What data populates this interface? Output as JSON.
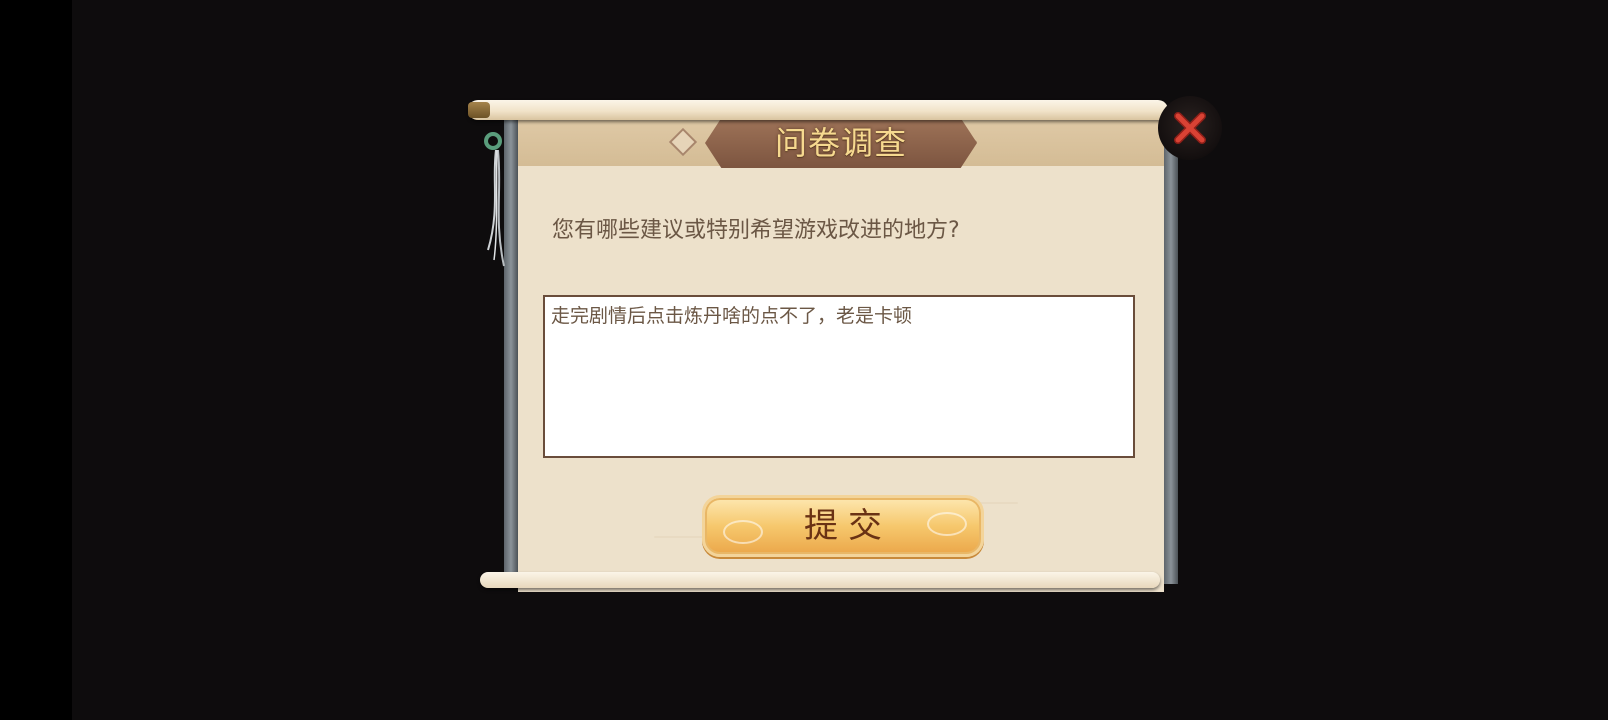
{
  "dialog": {
    "title": "问卷调查",
    "question": "您有哪些建议或特别希望游戏改进的地方?",
    "answer_value": "走完剧情后点击炼丹啥的点不了，老是卡顿",
    "submit_label": "提交"
  },
  "icons": {
    "close": "close-x-icon",
    "ornament": "jade-pendant-icon"
  },
  "colors": {
    "background": "#0e0c0d",
    "paper": "#ede1cb",
    "title_plate": "#8a614b",
    "title_text": "#f6d98f",
    "text": "#6b5745",
    "button": "#f6c86d",
    "close_x": "#d53a2f"
  }
}
